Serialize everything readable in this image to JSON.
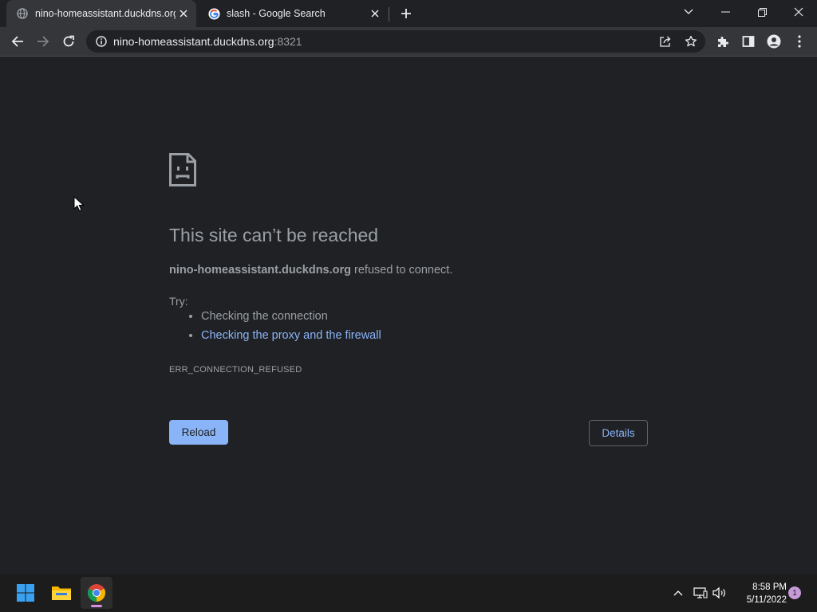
{
  "tabs": [
    {
      "title": "nino-homeassistant.duckdns.org",
      "icon": "globe-icon",
      "active": true
    },
    {
      "title": "slash - Google Search",
      "icon": "google-icon",
      "active": false
    }
  ],
  "address_bar": {
    "host": "nino-homeassistant.duckdns.org",
    "port": ":8321"
  },
  "error_page": {
    "title": "This site can’t be reached",
    "host_bold": "nino-homeassistant.duckdns.org",
    "message_rest": " refused to connect.",
    "try_label": "Try:",
    "suggestions": [
      "Checking the connection",
      "Checking the proxy and the firewall"
    ],
    "error_code": "ERR_CONNECTION_REFUSED",
    "reload_label": "Reload",
    "details_label": "Details"
  },
  "taskbar": {
    "time": "8:58 PM",
    "date": "5/11/2022",
    "notification_count": "1"
  },
  "colors": {
    "background": "#202124",
    "link": "#8ab4f8",
    "muted_text": "#9aa0a6"
  }
}
